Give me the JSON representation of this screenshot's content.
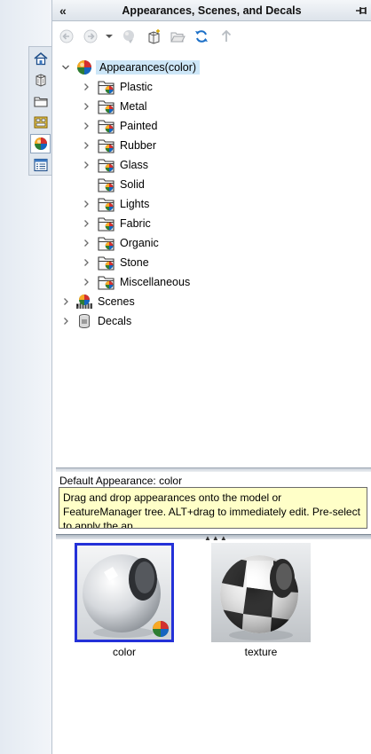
{
  "panel": {
    "title": "Appearances, Scenes, and Decals",
    "collapse_glyph": "«"
  },
  "side_tabs": [
    {
      "icon": "home-icon",
      "active": false
    },
    {
      "icon": "parts-icon",
      "active": false
    },
    {
      "icon": "folder-icon",
      "active": false
    },
    {
      "icon": "view-palette-icon",
      "active": false
    },
    {
      "icon": "appearances-icon",
      "active": true
    },
    {
      "icon": "custom-properties-icon",
      "active": false
    }
  ],
  "toolbar": {
    "buttons": [
      "back-icon",
      "forward-icon",
      "dropdown-icon",
      "add-to-favorites-icon",
      "new-folder-box-icon",
      "open-folder-icon",
      "refresh-icon",
      "up-level-icon"
    ]
  },
  "tree": {
    "root": {
      "label": "Appearances(color)",
      "icon": "appearances-ball-icon",
      "expanded": true
    },
    "children": [
      {
        "label": "Plastic",
        "has_children": true
      },
      {
        "label": "Metal",
        "has_children": true
      },
      {
        "label": "Painted",
        "has_children": true
      },
      {
        "label": "Rubber",
        "has_children": true
      },
      {
        "label": "Glass",
        "has_children": true
      },
      {
        "label": "Solid",
        "has_children": false
      },
      {
        "label": "Lights",
        "has_children": true
      },
      {
        "label": "Fabric",
        "has_children": true
      },
      {
        "label": "Organic",
        "has_children": true
      },
      {
        "label": "Stone",
        "has_children": true
      },
      {
        "label": "Miscellaneous",
        "has_children": true
      }
    ],
    "siblings": [
      {
        "label": "Scenes",
        "icon": "scenes-icon"
      },
      {
        "label": "Decals",
        "icon": "decals-icon"
      }
    ]
  },
  "info": {
    "default_label": "Default Appearance: color",
    "tip": "Drag and drop appearances onto the model or FeatureManager tree.  ALT+drag to immediately edit.  Pre-select to apply the ap..."
  },
  "thumbnails": [
    {
      "label": "color",
      "selected": true
    },
    {
      "label": "texture",
      "selected": false
    }
  ],
  "colors": {
    "selection_blue": "#2431d8",
    "tip_background": "#ffffc8",
    "tree_selection": "#cde6f7"
  }
}
